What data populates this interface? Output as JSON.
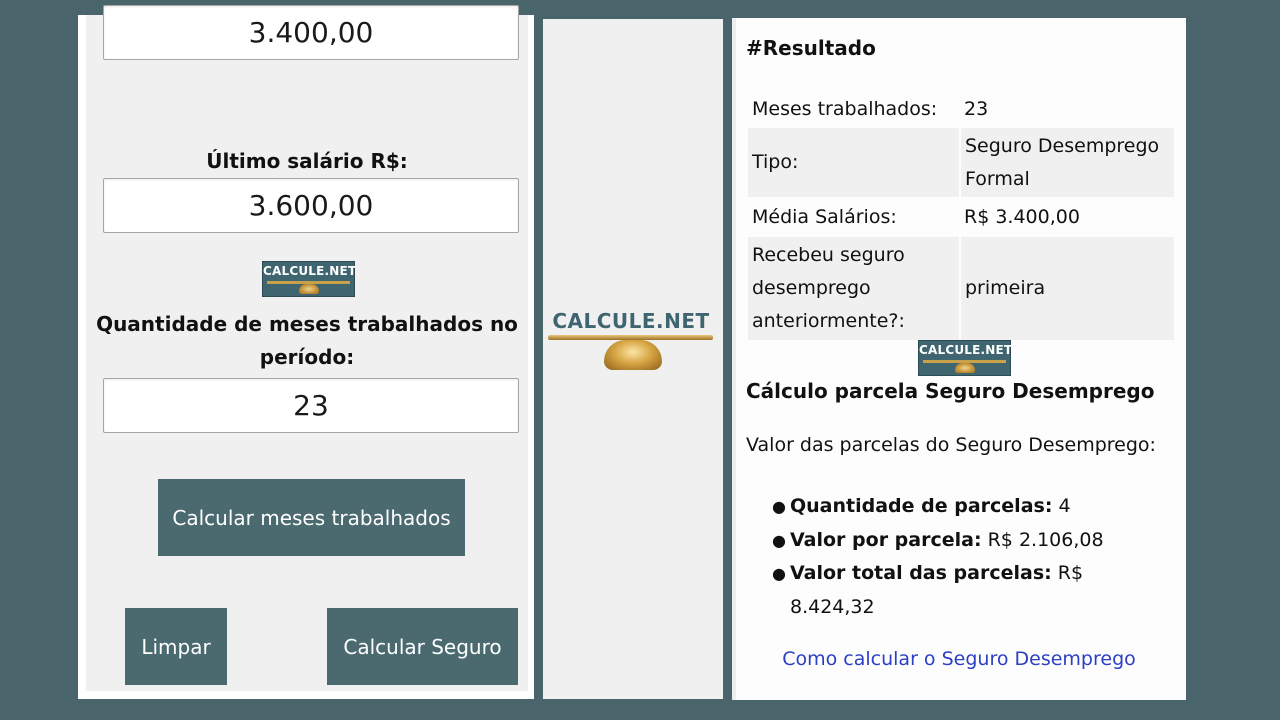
{
  "left": {
    "average_salary_value": "3.400,00",
    "last_salary_label": "Último salário R$:",
    "last_salary_value": "3.600,00",
    "logo_text": "CALCULE.NET",
    "months_label_line1": "Quantidade de meses trabalhados no",
    "months_label_line2": "período:",
    "months_value": "23",
    "calc_months_button": "Calcular meses trabalhados",
    "clear_button": "Limpar",
    "calc_insurance_button": "Calcular Seguro"
  },
  "middle": {
    "logo_text": "CALCULE.NET"
  },
  "right": {
    "title": "#Resultado",
    "rows": [
      {
        "key": "Meses trabalhados:",
        "value": "23"
      },
      {
        "key": "Tipo:",
        "value": "Seguro Desemprego Formal"
      },
      {
        "key": "Média Salários:",
        "value": "R$ 3.400,00"
      },
      {
        "key": "Recebeu seguro desemprego anteriormente?:",
        "value": "primeira"
      }
    ],
    "logo_text": "CALCULE.NET",
    "section_title": "Cálculo parcela Seguro Desemprego",
    "section_text": "Valor das parcelas do Seguro Desemprego:",
    "items": [
      {
        "label": "Quantidade de parcelas:",
        "value": "4"
      },
      {
        "label": "Valor por parcela:",
        "value": "R$ 2.106,08"
      },
      {
        "label": "Valor total das parcelas:",
        "value": "R$ 8.424,32"
      }
    ],
    "link": "Como calcular o Seguro Desemprego"
  },
  "colors": {
    "background": "#4a646b",
    "button": "#4a6a70",
    "link": "#2b3fc4"
  }
}
